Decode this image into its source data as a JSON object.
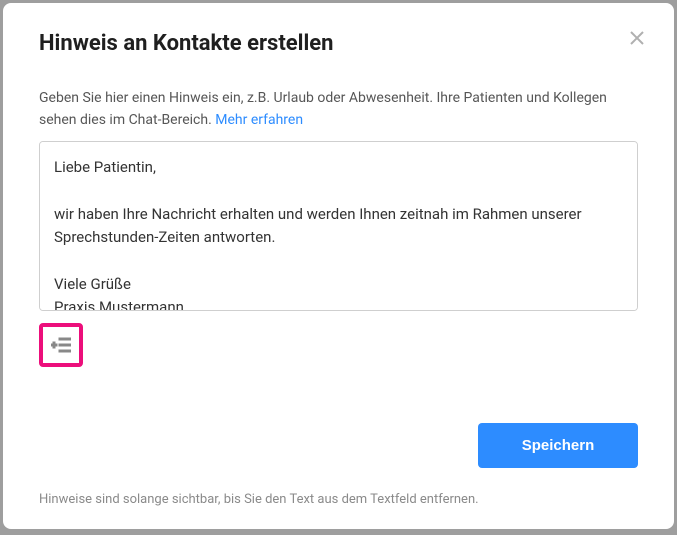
{
  "modal": {
    "title": "Hinweis an Kontakte erstellen",
    "description_pre": "Geben Sie hier einen Hinweis ein, z.B. Urlaub oder Abwesenheit. Ihre Patienten und Kollegen sehen dies im Chat-Bereich. ",
    "learn_more": "Mehr erfahren",
    "textarea_value": "Liebe Patientin,\n\nwir haben Ihre Nachricht erhalten und werden Ihnen zeitnah im Rahmen unserer Sprechstunden-Zeiten antworten.\n\nViele Grüße\nPraxis Mustermann",
    "save_label": "Speichern",
    "footer_note": "Hinweise sind solange sichtbar, bis Sie den Text aus dem Textfeld entfernen."
  },
  "icons": {
    "close": "close-icon",
    "add_list": "add-list-icon"
  }
}
